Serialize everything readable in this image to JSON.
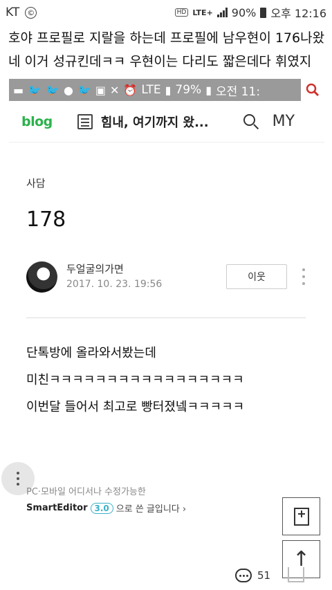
{
  "status_bar": {
    "carrier": "KT",
    "carrier_icon": "©",
    "hd": "HD",
    "network": "LTE+",
    "battery": "90%",
    "time": "오후 12:16"
  },
  "caption": {
    "line1": "호야 프로필로 지랄을 하는데 프로필에 남우현이 176나왔",
    "line2": "네 이거 성규킨데ㅋㅋ 우현이는 다리도 짧은데다 휘였지"
  },
  "inner_status": {
    "battery": "79%",
    "time": "오전 11:",
    "network": "LTE"
  },
  "blog_header": {
    "logo": "blog",
    "title": "힘내, 여기까지 왔...",
    "my_label": "MY"
  },
  "post": {
    "category": "사담",
    "title": "178",
    "author": "두얼굴의가면",
    "date": "2017. 10. 23. 19:56",
    "neighbor_button": "이웃",
    "body": [
      "단톡방에 올라와서봤는데",
      "미친ㅋㅋㅋㅋㅋㅋㅋㅋㅋㅋㅋㅋㅋㅋㅋㅋㅋ",
      "이번달 들어서 최고로 빵터졌넼ㅋㅋㅋㅋㅋ"
    ]
  },
  "footer": {
    "editor_note": "PC·모바일 어디서나 수정가능한",
    "smarteditor_brand": "SmartEditor",
    "smarteditor_version": "3.0",
    "smarteditor_suffix": "으로 쓴 글입니다 ›",
    "comment_count": "51"
  }
}
